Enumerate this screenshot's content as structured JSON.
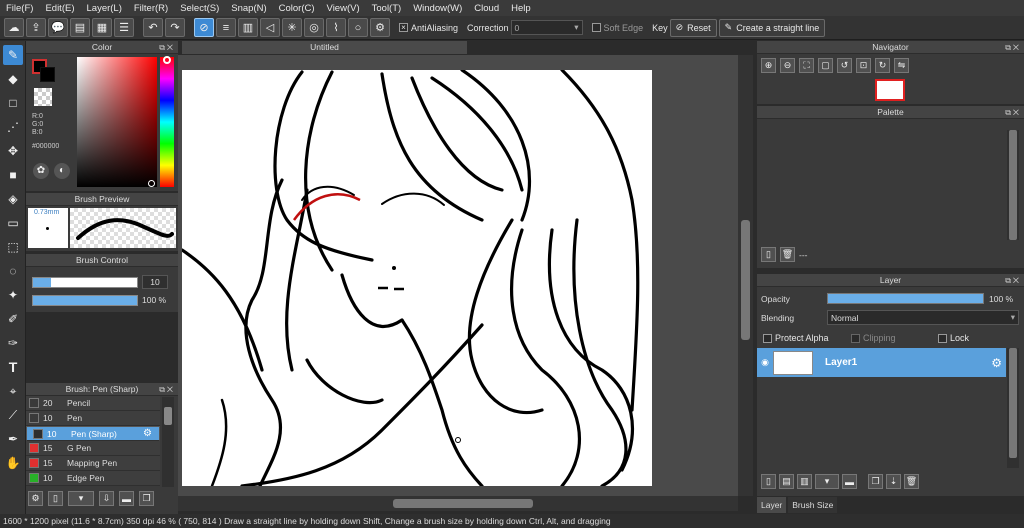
{
  "menu": [
    "File(F)",
    "Edit(E)",
    "Layer(L)",
    "Filter(R)",
    "Select(S)",
    "Snap(N)",
    "Color(C)",
    "View(V)",
    "Tool(T)",
    "Window(W)",
    "Cloud",
    "Help"
  ],
  "toolbar": {
    "antialiasing_label": "AntiAliasing",
    "correction_label": "Correction",
    "correction_value": "0",
    "soft_edge_label": "Soft Edge",
    "key_label": "Key",
    "reset_label": "Reset",
    "straight_line_label": "Create a straight line"
  },
  "color_panel": {
    "title": "Color",
    "r": "R:0",
    "g": "G:0",
    "b": "B:0",
    "hex": "#000000",
    "current_color": "#000000"
  },
  "brush_preview": {
    "title": "Brush Preview",
    "size": "0.73mm"
  },
  "brush_control": {
    "title": "Brush Control",
    "size_value": "10",
    "opacity_value": "100 %"
  },
  "brush_list": {
    "title": "Brush: Pen (Sharp)",
    "items": [
      {
        "num": "20",
        "name": "Pencil",
        "color": "#3a3a3a"
      },
      {
        "num": "10",
        "name": "Pen",
        "color": "#3a3a3a"
      },
      {
        "num": "10",
        "name": "Pen (Sharp)",
        "color": "#2e2e2e"
      },
      {
        "num": "15",
        "name": "G Pen",
        "color": "#e03030"
      },
      {
        "num": "15",
        "name": "Mapping Pen",
        "color": "#e03030"
      },
      {
        "num": "10",
        "name": "Edge Pen",
        "color": "#28b028"
      }
    ]
  },
  "document": {
    "tab_title": "Untitled"
  },
  "navigator": {
    "title": "Navigator"
  },
  "palette": {
    "title": "Palette",
    "label": "---"
  },
  "layer_panel": {
    "title": "Layer",
    "opacity_label": "Opacity",
    "opacity_value": "100 %",
    "opacity_fraction": 1.0,
    "blending_label": "Blending",
    "blending_value": "Normal",
    "protect_alpha_label": "Protect Alpha",
    "clipping_label": "Clipping",
    "lock_label": "Lock",
    "layers": [
      {
        "name": "Layer1"
      }
    ]
  },
  "bottom_tabs": [
    "Layer",
    "Brush Size"
  ],
  "status": {
    "canvas_size": "1600 * 1200 pixel",
    "physical_size": "(11.6 * 8.7cm)",
    "dpi": "350 dpi",
    "zoom": "46 %",
    "cursor": "( 750, 814 )",
    "hint": "Draw a straight line by holding down Shift, Change a brush size by holding down Ctrl, Alt, and dragging"
  },
  "colors": {
    "accent": "#3d8ad4",
    "selected_row": "#5aa0dc"
  }
}
